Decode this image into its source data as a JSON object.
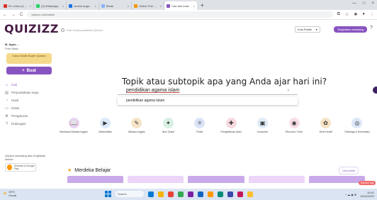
{
  "browser": {
    "tabs": [
      {
        "title": "Pe: Inbox (43) - agusmonro",
        "fav": "#d93025"
      },
      {
        "title": "(3) WhatsApp",
        "fav": "#25d366"
      },
      {
        "title": "contoh angket sikap",
        "fav": "#1a73e8"
      },
      {
        "title": "Bimbi",
        "fav": "#8ab4f8"
      },
      {
        "title": "Online Pub Gaussian Quiz",
        "fav": "#f29900"
      },
      {
        "title": "Cari dan buat Kuis",
        "fav": "#8854c0"
      }
    ],
    "active_tab": 5,
    "new_tab": "+",
    "url": "quizizz.com/admin",
    "window_controls": [
      "—",
      "□",
      "×"
    ],
    "nav_icons": [
      "←",
      "→",
      "C",
      "⌂"
    ]
  },
  "header": {
    "logo": "QUIZIZZ",
    "search_placeholder": "Cari di perpustakaan Quizizz",
    "library": "Kuis Publik",
    "library_chevron": "▾",
    "upgrade": "Tingkatkan sekarang",
    "help": "?"
  },
  "sidebar": {
    "username": "M. Agus…",
    "usersub": "Free Basic",
    "promo": "Coba Gratis Super Quizizz",
    "create_label": "Buat",
    "create_icon": "+",
    "items": [
      {
        "label": "Cari",
        "icon": "⌂"
      },
      {
        "label": "Perpustakaan saya",
        "icon": "▤"
      },
      {
        "label": "Hasil",
        "icon": "◔"
      },
      {
        "label": "Kelas",
        "icon": "▭"
      },
      {
        "label": "Pengaturan",
        "icon": "⚙"
      },
      {
        "label": "Dukungan",
        "icon": "?"
      }
    ],
    "footer_text": "Quizizz sekarang ada di aplikasi seluler",
    "app_store": "Tersedia di Google Play"
  },
  "main": {
    "headline": "Topik atau subtopik apa yang Anda ajar hari ini?",
    "topic_value": "pendidikan agama islam",
    "topic_chevron": "›",
    "suggestion": "pendidikan agama Islam",
    "subjects": [
      {
        "label": "Membaca Bahasa Inggris",
        "icon": "📖",
        "color": "#e7d3f3"
      },
      {
        "label": "Matematika",
        "icon": "▶",
        "color": "#dbe9f8"
      },
      {
        "label": "Bahasa Inggris",
        "icon": "✎",
        "color": "#f6e3c7"
      },
      {
        "label": "Ilmu Sosial",
        "icon": "✦",
        "color": "#d7f0e3"
      },
      {
        "label": "Fisika",
        "icon": "⚛",
        "color": "#dbe3f8"
      },
      {
        "label": "Pengetahuan Alam",
        "icon": "✚",
        "color": "#f8d9df"
      },
      {
        "label": "Komputer",
        "icon": "▣",
        "color": "#e0ecf8"
      },
      {
        "label": "Ekonomi / Karir",
        "icon": "◉",
        "color": "#f8dde8"
      },
      {
        "label": "Seni Kreatif",
        "icon": "✿",
        "color": "#f7e2c6"
      },
      {
        "label": "Olahraga & Kesehatan",
        "icon": "◎",
        "color": "#dbe7f8"
      }
    ],
    "section_title": "Merdeka Belajar",
    "section_star": "★",
    "see_all": "Lihat lebih"
  },
  "widget_tag": "Sinkron lagi",
  "taskbar": {
    "temp": "29°C",
    "weather": "Cerah",
    "search": "Search",
    "apps": [
      "#0078d4",
      "#f4b400",
      "#e94235",
      "#34a853",
      "#7b1fa2",
      "#1565c0",
      "#ff9800",
      "#00897b",
      "#3949ab",
      "#c2185b",
      "#fbc02d"
    ],
    "time": "10:41",
    "date": "10/11/2022",
    "tray_icons": "^ ☁ ◉ ⊞"
  }
}
